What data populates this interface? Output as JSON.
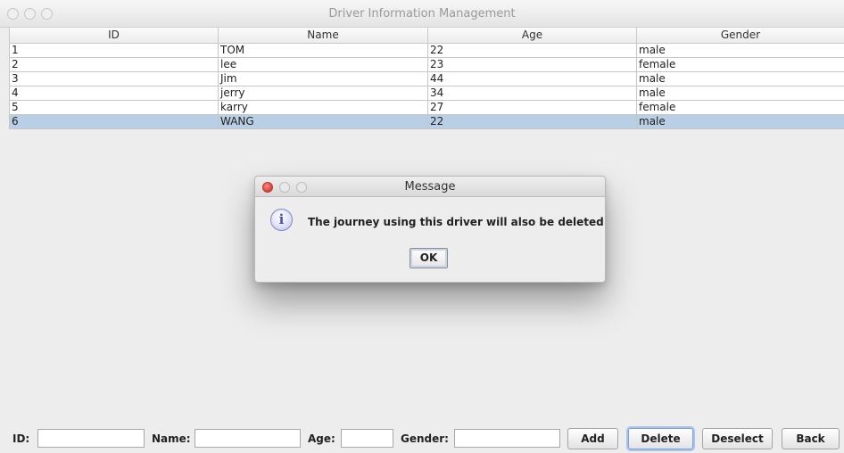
{
  "window": {
    "title": "Driver Information Management"
  },
  "table": {
    "columns": [
      "ID",
      "Name",
      "Age",
      "Gender"
    ],
    "rows": [
      [
        "1",
        "TOM",
        "22",
        "male"
      ],
      [
        "2",
        "lee",
        "23",
        "female"
      ],
      [
        "3",
        "Jim",
        "44",
        "male"
      ],
      [
        "4",
        "jerry",
        "34",
        "male"
      ],
      [
        "5",
        "karry",
        "27",
        "female"
      ],
      [
        "6",
        "WANG",
        "22",
        "male"
      ]
    ],
    "selected_row": 6
  },
  "dialog": {
    "title": "Message",
    "message": "The journey using this driver will also be deleted",
    "ok_label": "OK",
    "icon": "info-icon"
  },
  "form": {
    "id_label": "ID:",
    "id_value": "",
    "name_label": "Name:",
    "name_value": "",
    "age_label": "Age:",
    "age_value": "",
    "gender_label": "Gender:",
    "gender_value": ""
  },
  "buttons": {
    "add": "Add",
    "delete": "Delete",
    "deselect": "Deselect",
    "back": "Back"
  },
  "colors": {
    "selection": "#b8cfe5",
    "close_button": "#e2463f"
  }
}
